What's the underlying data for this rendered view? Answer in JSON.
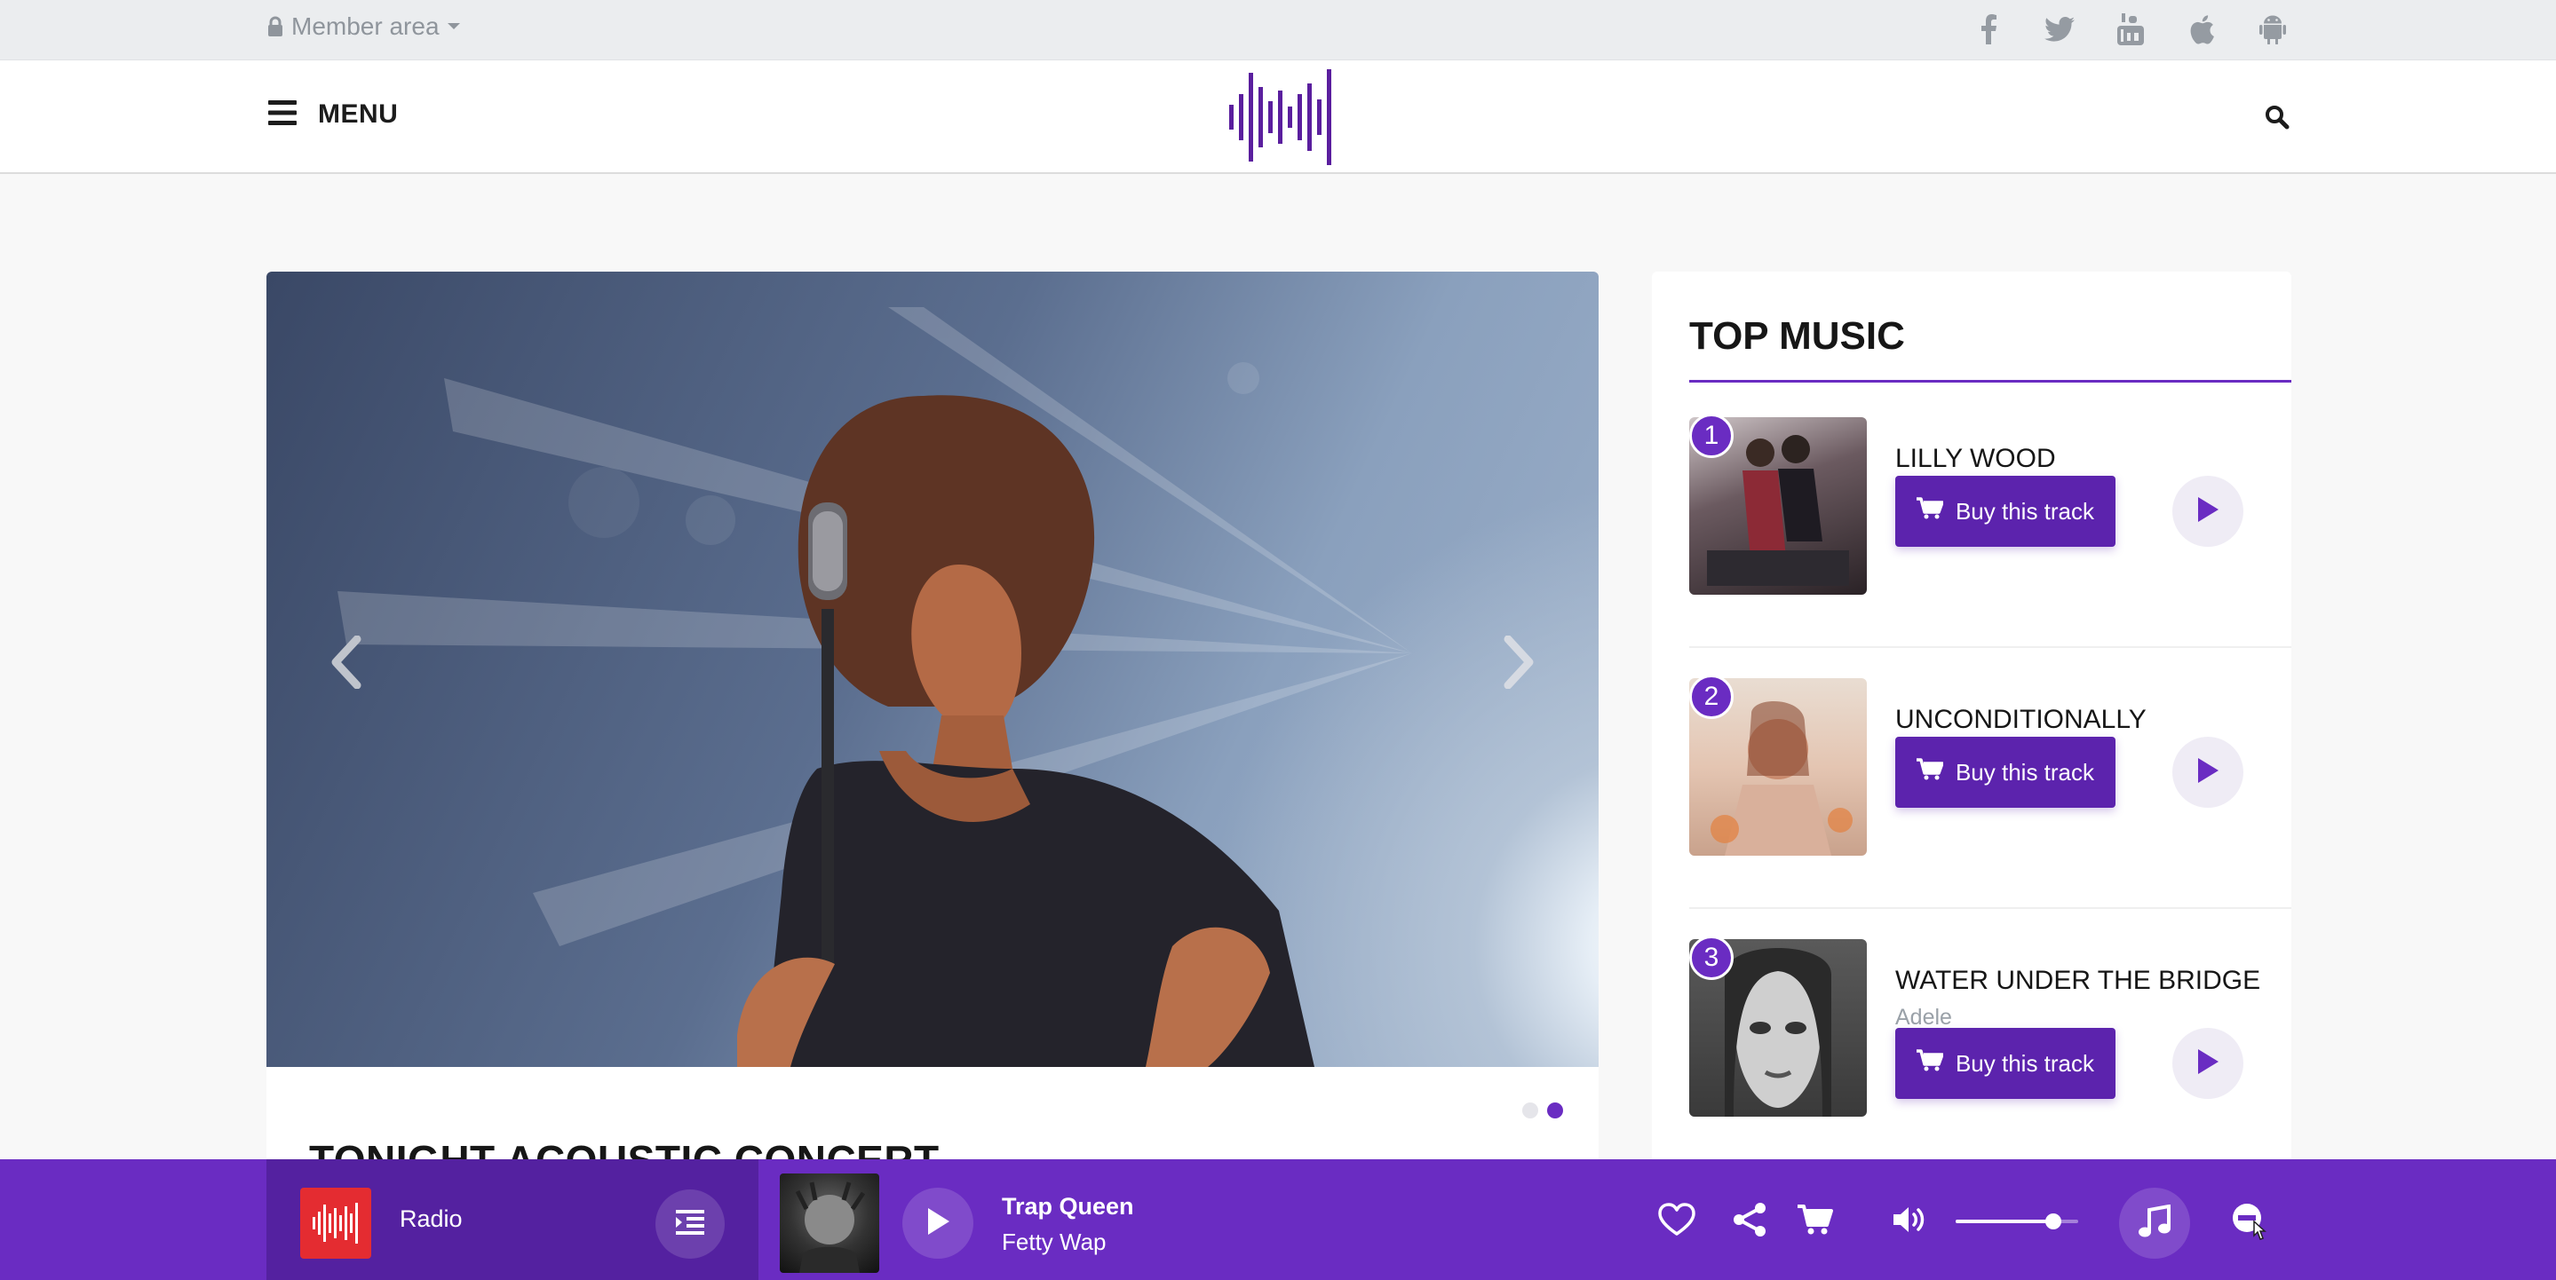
{
  "topbar": {
    "member_area": "Member area",
    "social_icons": [
      "facebook-icon",
      "twitter-icon",
      "youtube-icon",
      "apple-icon",
      "android-icon"
    ]
  },
  "header": {
    "menu_label": "MENU"
  },
  "hero": {
    "title": "TONIGHT ACOUSTIC CONCERT",
    "slides_total": 2,
    "active_slide": 2
  },
  "top_music": {
    "title": "TOP MUSIC",
    "buy_label": "Buy this track",
    "tracks": [
      {
        "rank": "1",
        "title": "LILLY WOOD",
        "artist": ""
      },
      {
        "rank": "2",
        "title": "UNCONDITIONALLY",
        "artist": ""
      },
      {
        "rank": "3",
        "title": "WATER UNDER THE BRIDGE",
        "artist": "Adele"
      }
    ]
  },
  "player": {
    "radio_label": "Radio",
    "now_playing_title": "Trap Queen",
    "now_playing_artist": "Fetty Wap",
    "volume_fraction": 0.8
  },
  "colors": {
    "accent": "#6a2cc2",
    "accent_dark": "#5c23ad",
    "radio_red": "#e42c31"
  }
}
